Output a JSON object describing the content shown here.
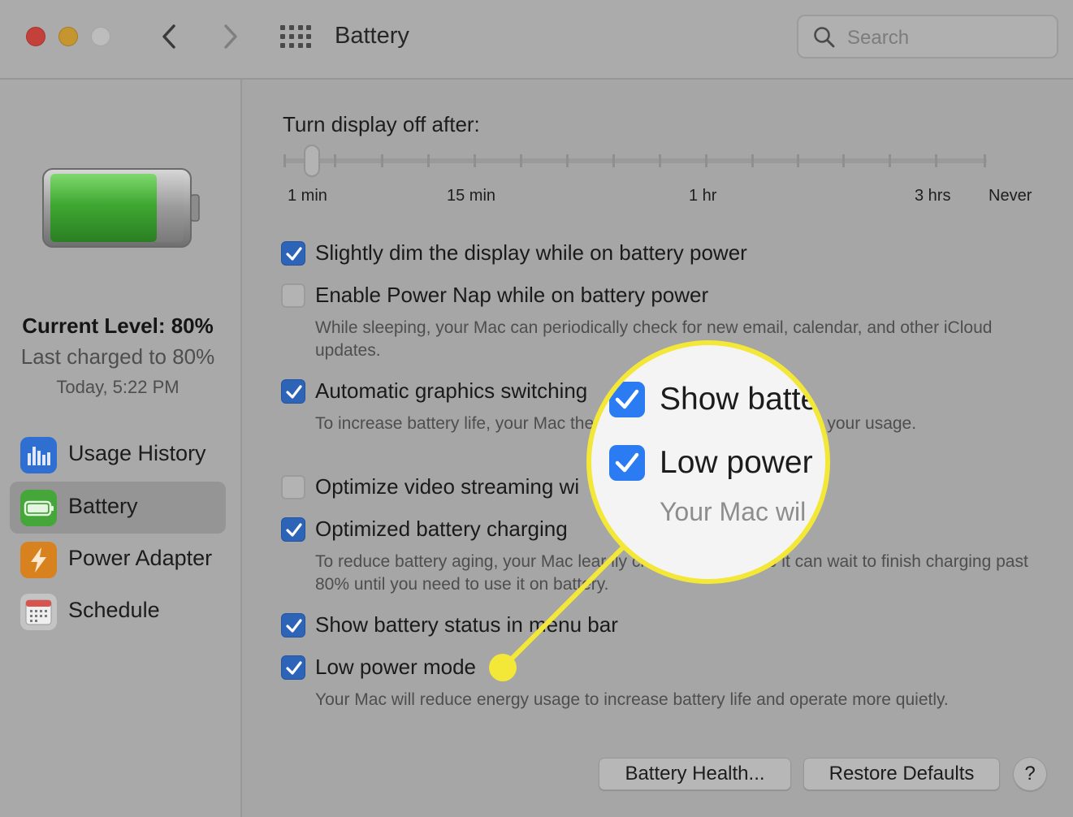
{
  "window": {
    "title": "Battery",
    "search_placeholder": "Search"
  },
  "sidebar": {
    "current_level": "Current Level: 80%",
    "last_charged": "Last charged to 80%",
    "last_charged_time": "Today, 5:22 PM",
    "battery_level_fraction": 0.8,
    "items": [
      {
        "label": "Usage History",
        "icon": "usage-history-icon",
        "selected": false
      },
      {
        "label": "Battery",
        "icon": "battery-icon",
        "selected": true
      },
      {
        "label": "Power Adapter",
        "icon": "power-adapter-icon",
        "selected": false
      },
      {
        "label": "Schedule",
        "icon": "schedule-icon",
        "selected": false
      }
    ]
  },
  "display_slider": {
    "label": "Turn display off after:",
    "tick_labels": [
      "1 min",
      "15 min",
      "1 hr",
      "3 hrs",
      "Never"
    ],
    "value": "1 min"
  },
  "options": [
    {
      "label": "Slightly dim the display while on battery power",
      "checked": true,
      "description": ""
    },
    {
      "label": "Enable Power Nap while on battery power",
      "checked": false,
      "description": "While sleeping, your Mac can periodically check for new email, calendar, and other iCloud updates."
    },
    {
      "label": "Automatic graphics switching",
      "checked": true,
      "description": "To increase battery life, your Mac the best graphics mode based on your usage."
    },
    {
      "label": "Optimize video streaming wi",
      "checked": false,
      "description": ""
    },
    {
      "label": "Optimized battery charging",
      "checked": true,
      "description": "To reduce battery aging, your Mac lear ily charging routine so it can wait to finish charging past 80% until you need to use it on battery."
    },
    {
      "label": "Show battery status in menu bar",
      "checked": true,
      "description": ""
    },
    {
      "label": "Low power mode",
      "checked": true,
      "description": "Your Mac will reduce energy usage to increase battery life and operate more quietly."
    }
  ],
  "buttons": {
    "battery_health": "Battery Health...",
    "restore_defaults": "Restore Defaults",
    "help": "?"
  },
  "magnifier": {
    "line1": "Show batte",
    "line2": "Low power",
    "line3": "Your Mac wil",
    "highlight_color": "#f3e737"
  },
  "colors": {
    "checkbox_on": "#2d64b8",
    "battery_green": "#3fa832"
  }
}
